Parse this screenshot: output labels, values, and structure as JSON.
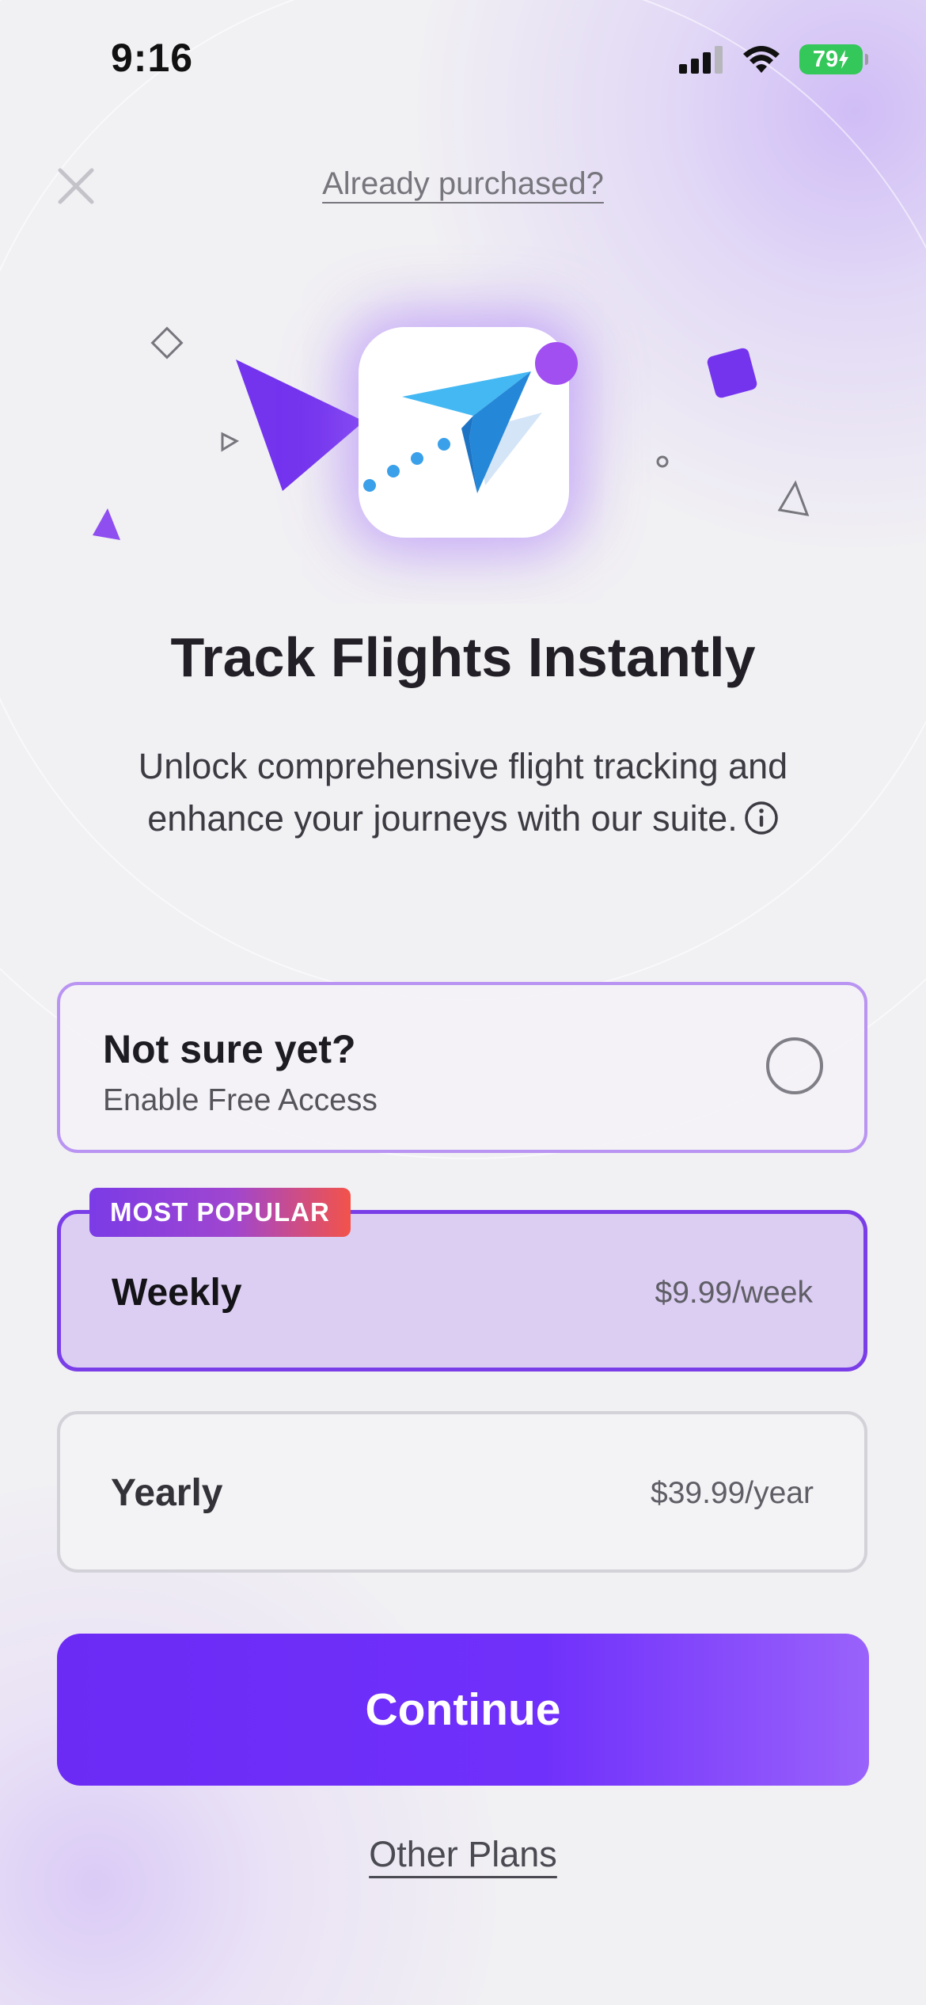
{
  "status_bar": {
    "time": "9:16",
    "battery": "79"
  },
  "header": {
    "already_purchased": "Already purchased?"
  },
  "hero": {
    "title": "Track Flights Instantly",
    "subtitle": "Unlock comprehensive flight tracking and enhance your journeys with our suite."
  },
  "plans": {
    "free": {
      "title": "Not sure yet?",
      "subtitle": "Enable Free Access"
    },
    "badge": "MOST POPULAR",
    "weekly": {
      "name": "Weekly",
      "price": "$9.99/week"
    },
    "yearly": {
      "name": "Yearly",
      "price": "$39.99/year"
    }
  },
  "actions": {
    "continue": "Continue",
    "other_plans": "Other Plans"
  },
  "colors": {
    "accent": "#7030fb",
    "selected_card_bg": "#dccdf2",
    "badge_start": "#7b3be6",
    "badge_end": "#f2534a",
    "battery": "#34c759"
  }
}
